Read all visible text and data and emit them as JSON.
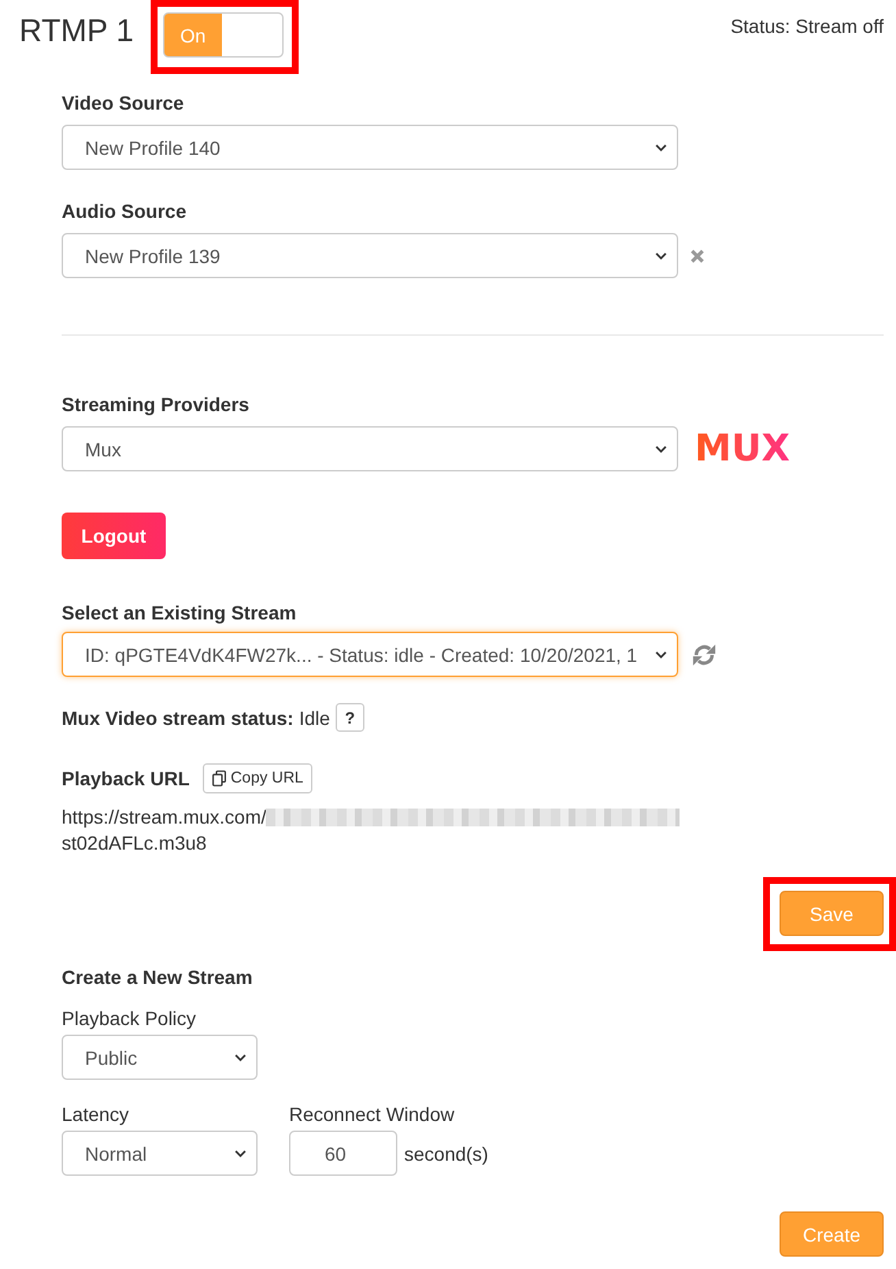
{
  "header": {
    "title": "RTMP 1",
    "toggle": {
      "label": "On",
      "on": true,
      "highlighted": true
    },
    "status": "Status: Stream off"
  },
  "sources": [
    {
      "label": "Video Source",
      "value": "New Profile 140",
      "removable": false
    },
    {
      "label": "Audio Source",
      "value": "New Profile 139",
      "removable": true
    }
  ],
  "provider": {
    "label": "Streaming Providers",
    "value": "Mux",
    "logo": "MUX"
  },
  "logout_button": "Logout",
  "existing_stream": {
    "label": "Select an Existing Stream",
    "value": "ID: qPGTE4VdK4FW27k... - Status: idle - Created: 10/20/2021, 1",
    "focused": true
  },
  "stream_status": {
    "label": "Mux Video stream status:",
    "value": "Idle",
    "help_button": "?"
  },
  "playback_url": {
    "label": "Playback URL",
    "copy_button": "Copy URL",
    "lines": [
      "https://stream.mux.com/",
      "st02dAFLc.m3u8"
    ],
    "redacted": true
  },
  "save_button": {
    "label": "Save",
    "highlighted": true
  },
  "new_stream": {
    "title": "Create a New Stream",
    "playback_policy": {
      "label": "Playback Policy",
      "value": "Public"
    },
    "latency": {
      "label": "Latency",
      "value": "Normal"
    },
    "reconnect_window": {
      "label": "Reconnect Window",
      "value": "60",
      "unit": "second(s)"
    },
    "create_button": "Create"
  }
}
